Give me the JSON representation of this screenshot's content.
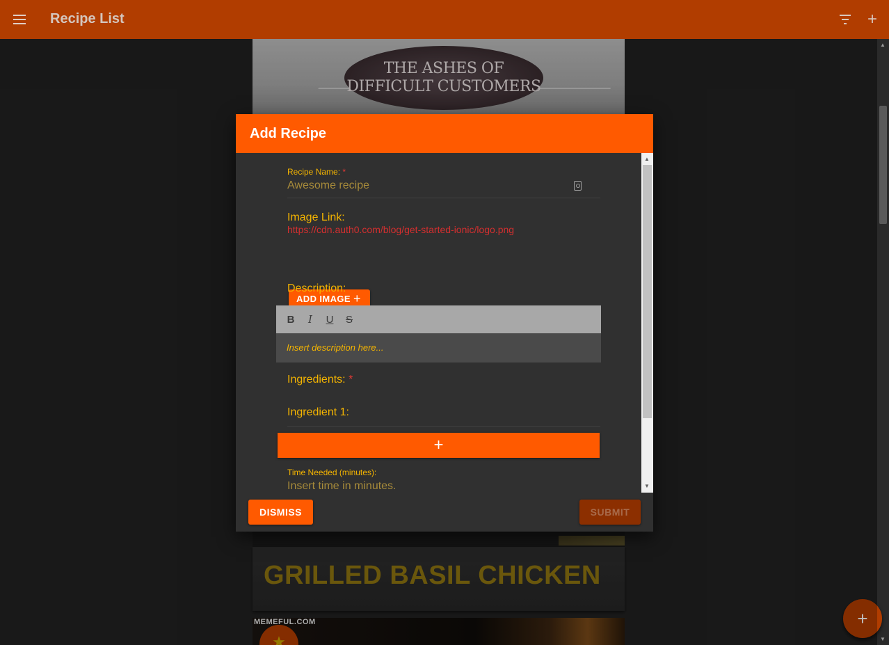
{
  "app_bar": {
    "title": "Recipe List",
    "menu_icon": "menu-icon",
    "filter_icon": "filter-icon",
    "add_icon": "add-icon",
    "color": "#b13d00"
  },
  "background_list": {
    "card1_image_text": [
      "THE ASHES OF",
      "DIFFICULT CUSTOMERS"
    ],
    "card2_title": "GRILLED BASIL CHICKEN",
    "card3_watermark": "MEMEFUL.COM",
    "card3_badge_icon": "star-icon"
  },
  "fab": {
    "icon": "add-icon"
  },
  "dialog": {
    "title": "Add Recipe",
    "header_color": "#ff5a00",
    "recipe_name": {
      "label": "Recipe Name:",
      "required_mark": "*",
      "placeholder": "Awesome recipe",
      "icon": "contact-card-icon"
    },
    "image_link": {
      "label": "Image Link:",
      "url": "https://cdn.auth0.com/blog/get-started-ionic/logo.png"
    },
    "add_image_button": "ADD IMAGE",
    "description": {
      "label": "Description:",
      "toolbar": [
        "B",
        "I",
        "U",
        "S"
      ],
      "placeholder": "Insert description here..."
    },
    "ingredients": {
      "label": "Ingredients:",
      "required_mark": "*",
      "items": [
        {
          "label": "Ingredient 1:"
        }
      ],
      "add_button_icon": "plus-icon"
    },
    "time_needed": {
      "label": "Time Needed (minutes):",
      "placeholder": "Insert time in minutes."
    },
    "footer": {
      "dismiss_label": "DISMISS",
      "submit_label": "SUBMIT"
    }
  }
}
